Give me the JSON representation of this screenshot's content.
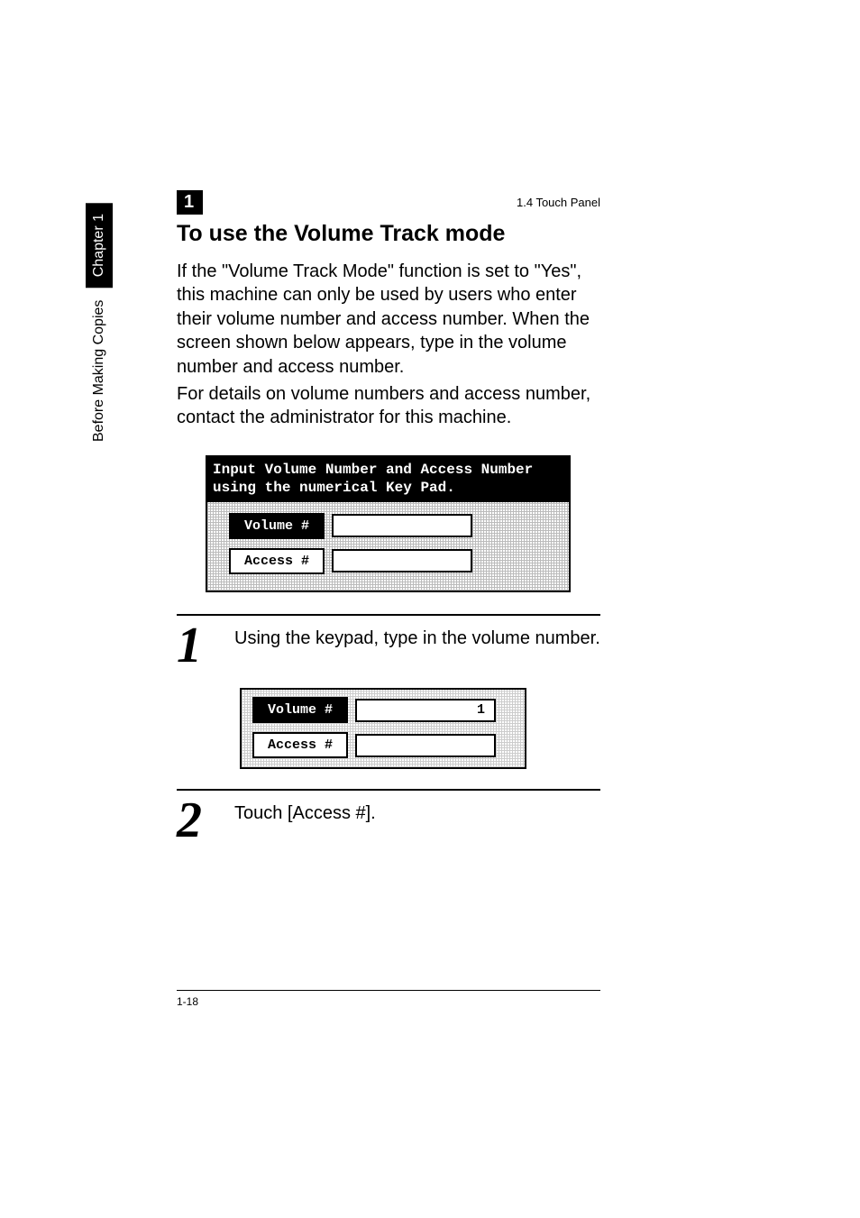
{
  "header": {
    "chapter_number": "1",
    "running_head": "1.4 Touch Panel"
  },
  "sidebar": {
    "chapter_label": "Chapter 1",
    "section_label": "Before Making Copies"
  },
  "heading": "To use the Volume Track mode",
  "para1": "If the \"Volume Track Mode\" function is set to \"Yes\", this machine can only be used by users who enter their volume number and access number. When the screen shown below appears, type in the volume number and access number.",
  "para2": "For details on volume numbers and access number, contact the administrator for this machine.",
  "panel1": {
    "title_line1": "Input Volume Number and Access Number",
    "title_line2": "using the numerical Key Pad.",
    "volume_btn": "Volume #",
    "access_btn": "Access #",
    "volume_val": "",
    "access_val": ""
  },
  "step1": {
    "num": "1",
    "text": "Using the keypad, type in the volume number."
  },
  "panel2": {
    "volume_btn": "Volume #",
    "access_btn": "Access #",
    "volume_val": "1",
    "access_val": ""
  },
  "step2": {
    "num": "2",
    "text": "Touch [Access #]."
  },
  "footer": {
    "page_num": "1-18"
  }
}
